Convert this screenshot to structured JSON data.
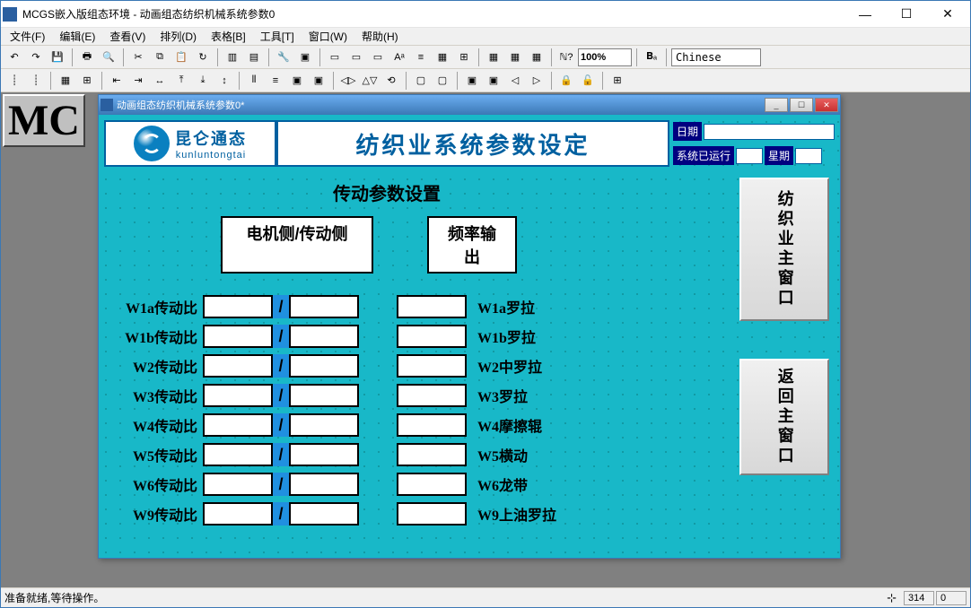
{
  "app": {
    "title": "MCGS嵌入版组态环境 - 动画组态纺织机械系统参数0",
    "bg_logo": "MC"
  },
  "menu": {
    "file": "文件(F)",
    "edit": "编辑(E)",
    "view": "查看(V)",
    "arrange": "排列(D)",
    "table": "表格[B]",
    "tools": "工具[T]",
    "window": "窗口(W)",
    "help": "帮助(H)"
  },
  "toolbar": {
    "zoom": "100%",
    "language": "Chinese"
  },
  "child": {
    "title": "动画组态纺织机械系统参数0*"
  },
  "logo": {
    "cn": "昆仑通态",
    "en": "kunluntongtai"
  },
  "page_title": "纺织业系统参数设定",
  "info": {
    "date_label": "日期",
    "runtime_label": "系统已运行",
    "week_label": "星期",
    "date_value": "",
    "runtime_value": "",
    "week_value": ""
  },
  "section": {
    "title": "传动参数设置",
    "col_a": "电机侧/传动侧",
    "col_b": "频率输出"
  },
  "rows": [
    {
      "left": "W1a传动比",
      "a1": "",
      "a2": "",
      "b": "",
      "right": "W1a罗拉"
    },
    {
      "left": "W1b传动比",
      "a1": "",
      "a2": "",
      "b": "",
      "right": "W1b罗拉"
    },
    {
      "left": "W2传动比",
      "a1": "",
      "a2": "",
      "b": "",
      "right": "W2中罗拉"
    },
    {
      "left": "W3传动比",
      "a1": "",
      "a2": "",
      "b": "",
      "right": "W3罗拉"
    },
    {
      "left": "W4传动比",
      "a1": "",
      "a2": "",
      "b": "",
      "right": "W4摩擦辊"
    },
    {
      "left": "W5传动比",
      "a1": "",
      "a2": "",
      "b": "",
      "right": "W5横动"
    },
    {
      "left": "W6传动比",
      "a1": "",
      "a2": "",
      "b": "",
      "right": "W6龙带"
    },
    {
      "left": "W9传动比",
      "a1": "",
      "a2": "",
      "b": "",
      "right": "W9上油罗拉"
    }
  ],
  "buttons": {
    "main_window": "纺织业主窗口",
    "return_main": "返回主窗口"
  },
  "status": {
    "text": "准备就绪,等待操作。",
    "coord_icon": "⊹",
    "x": "314",
    "y": "0"
  }
}
